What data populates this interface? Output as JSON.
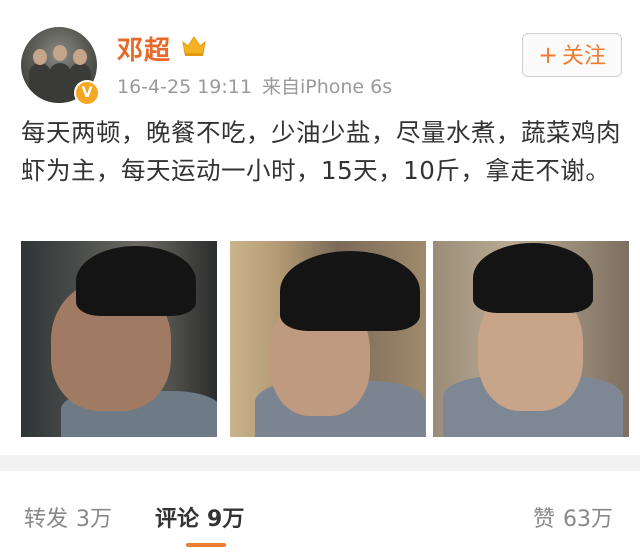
{
  "user": {
    "name": "邓超",
    "verified_badge": "V",
    "crown_icon": "crown-icon"
  },
  "post_meta": {
    "date": "16-4-25 19:11",
    "source": "来自iPhone 6s"
  },
  "follow_button": {
    "plus": "+",
    "label": "关注"
  },
  "post": {
    "text": "每天两顿，晚餐不吃，少油少盐，尽量水煮，蔬菜鸡肉虾为主，每天运动一小时，15天，10斤，拿走不谢。"
  },
  "actions": {
    "repost_label": "转发",
    "repost_count": "3万",
    "comment_label": "评论",
    "comment_count": "9万",
    "like_label": "赞",
    "like_count": "63万"
  },
  "colors": {
    "accent": "#f07c32",
    "name": "#e86a2a",
    "meta": "#9a9a9a"
  }
}
